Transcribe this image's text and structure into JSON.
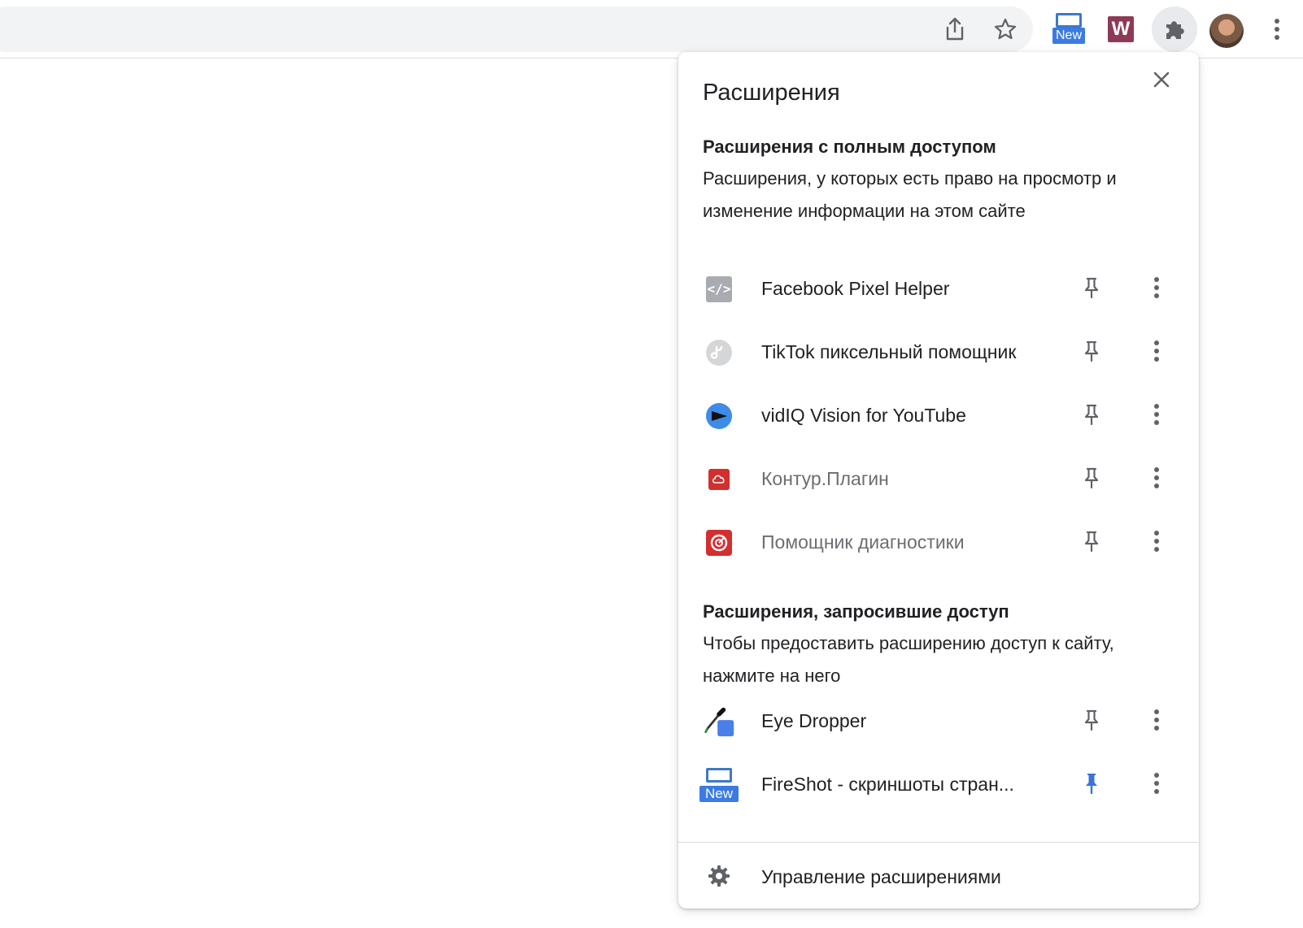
{
  "toolbar": {
    "fireshot_badge": "New",
    "w_extension_letter": "W"
  },
  "popup": {
    "title": "Расширения",
    "full_access": {
      "heading": "Расширения с полным доступом",
      "description": "Расширения, у которых есть право на просмотр и изменение информации на этом сайте",
      "items": [
        {
          "name": "Facebook Pixel Helper",
          "icon": "code-icon",
          "muted": false,
          "pinned": false
        },
        {
          "name": "TikTok пиксельный помощник",
          "icon": "tiktok-icon",
          "muted": false,
          "pinned": false
        },
        {
          "name": "vidIQ Vision for YouTube",
          "icon": "vidiq-icon",
          "muted": false,
          "pinned": false
        },
        {
          "name": "Контур.Плагин",
          "icon": "cloud-icon",
          "muted": true,
          "pinned": false
        },
        {
          "name": "Помощник диагностики",
          "icon": "diagnostics-icon",
          "muted": true,
          "pinned": false
        }
      ]
    },
    "requested_access": {
      "heading": "Расширения, запросившие доступ",
      "description": "Чтобы предоставить расширению доступ к сайту, нажмите на него",
      "items": [
        {
          "name": "Eye Dropper",
          "icon": "eye-dropper-icon",
          "muted": false,
          "pinned": false
        },
        {
          "name": "FireShot - скриншоты стран...",
          "icon": "fireshot-icon",
          "badge": "New",
          "muted": false,
          "pinned": true
        }
      ]
    },
    "manage_label": "Управление расширениями"
  },
  "colors": {
    "pin_active": "#3b73d9",
    "pin_inactive": "#5f6368",
    "muted_text": "#6b6e72"
  }
}
